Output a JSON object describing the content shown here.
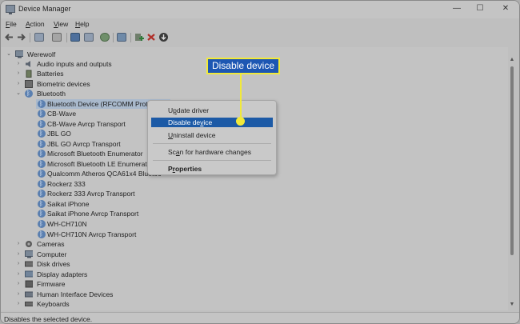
{
  "window": {
    "title": "Device Manager",
    "minimize_glyph": "—",
    "maximize_glyph": "☐",
    "close_glyph": "✕"
  },
  "menubar": {
    "items": [
      {
        "label": "File",
        "accel": "F",
        "rest": "ile"
      },
      {
        "label": "Action",
        "accel": "A",
        "rest": "ction"
      },
      {
        "label": "View",
        "accel": "V",
        "rest": "iew"
      },
      {
        "label": "Help",
        "accel": "H",
        "rest": "elp"
      }
    ]
  },
  "toolbar": {
    "icons": [
      "back-icon",
      "forward-icon",
      "properties-sheet-icon",
      "list-icon",
      "help-icon",
      "show-hidden-icon",
      "refresh-icon",
      "monitor-icon",
      "add-driver-icon",
      "remove-device-icon",
      "download-icon"
    ]
  },
  "tree": {
    "root": "Werewolf",
    "categories_top": [
      {
        "label": "Audio inputs and outputs",
        "icon": "speaker-icon"
      },
      {
        "label": "Batteries",
        "icon": "battery-icon"
      },
      {
        "label": "Biometric devices",
        "icon": "fingerprint-icon"
      },
      {
        "label": "Bluetooth",
        "icon": "bluetooth-icon"
      }
    ],
    "bluetooth_children": [
      "Bluetooth Device (RFCOMM Proto",
      "CB-Wave",
      "CB-Wave Avrcp Transport",
      "JBL GO",
      "JBL GO Avrcp Transport",
      "Microsoft Bluetooth Enumerator",
      "Microsoft Bluetooth LE Enumerato",
      "Qualcomm Atheros QCA61x4 Bluetoo",
      "Rockerz 333",
      "Rockerz 333 Avrcp Transport",
      "Saikat iPhone",
      "Saikat iPhone Avrcp Transport",
      "WH-CH710N",
      "WH-CH710N Avrcp Transport"
    ],
    "categories_bottom": [
      {
        "label": "Cameras",
        "icon": "camera-icon"
      },
      {
        "label": "Computer",
        "icon": "computer-icon"
      },
      {
        "label": "Disk drives",
        "icon": "disk-icon"
      },
      {
        "label": "Display adapters",
        "icon": "display-icon"
      },
      {
        "label": "Firmware",
        "icon": "chip-icon"
      },
      {
        "label": "Human Interface Devices",
        "icon": "hid-icon"
      },
      {
        "label": "Keyboards",
        "icon": "keyboard-icon"
      }
    ]
  },
  "context_menu": {
    "update": {
      "pre": "",
      "accel": "P",
      "post": "",
      "label": "Update driver",
      "text_a": "U",
      "text_b": "p",
      "text_c": "date driver"
    },
    "disable": {
      "label": "Disable device",
      "pre": "Disable de",
      "accel": "v",
      "post": "ice"
    },
    "uninstall": {
      "label": "Uninstall device",
      "accel": "U",
      "post": "ninstall device"
    },
    "scan": {
      "label": "Scan for hardware changes",
      "pre": "Sc",
      "accel": "a",
      "post": "n for hardware changes"
    },
    "properties": {
      "label": "Properties",
      "accel": "r",
      "pre": "P",
      "post": "operties"
    }
  },
  "callout": {
    "text": "Disable device",
    "border_color": "#f1e93a",
    "fill_color": "#1d57b3"
  },
  "status": {
    "text": "Disables the selected device."
  },
  "colors": {
    "highlight": "#1c5aa6",
    "bluetooth_icon": "#5a7fb0"
  }
}
